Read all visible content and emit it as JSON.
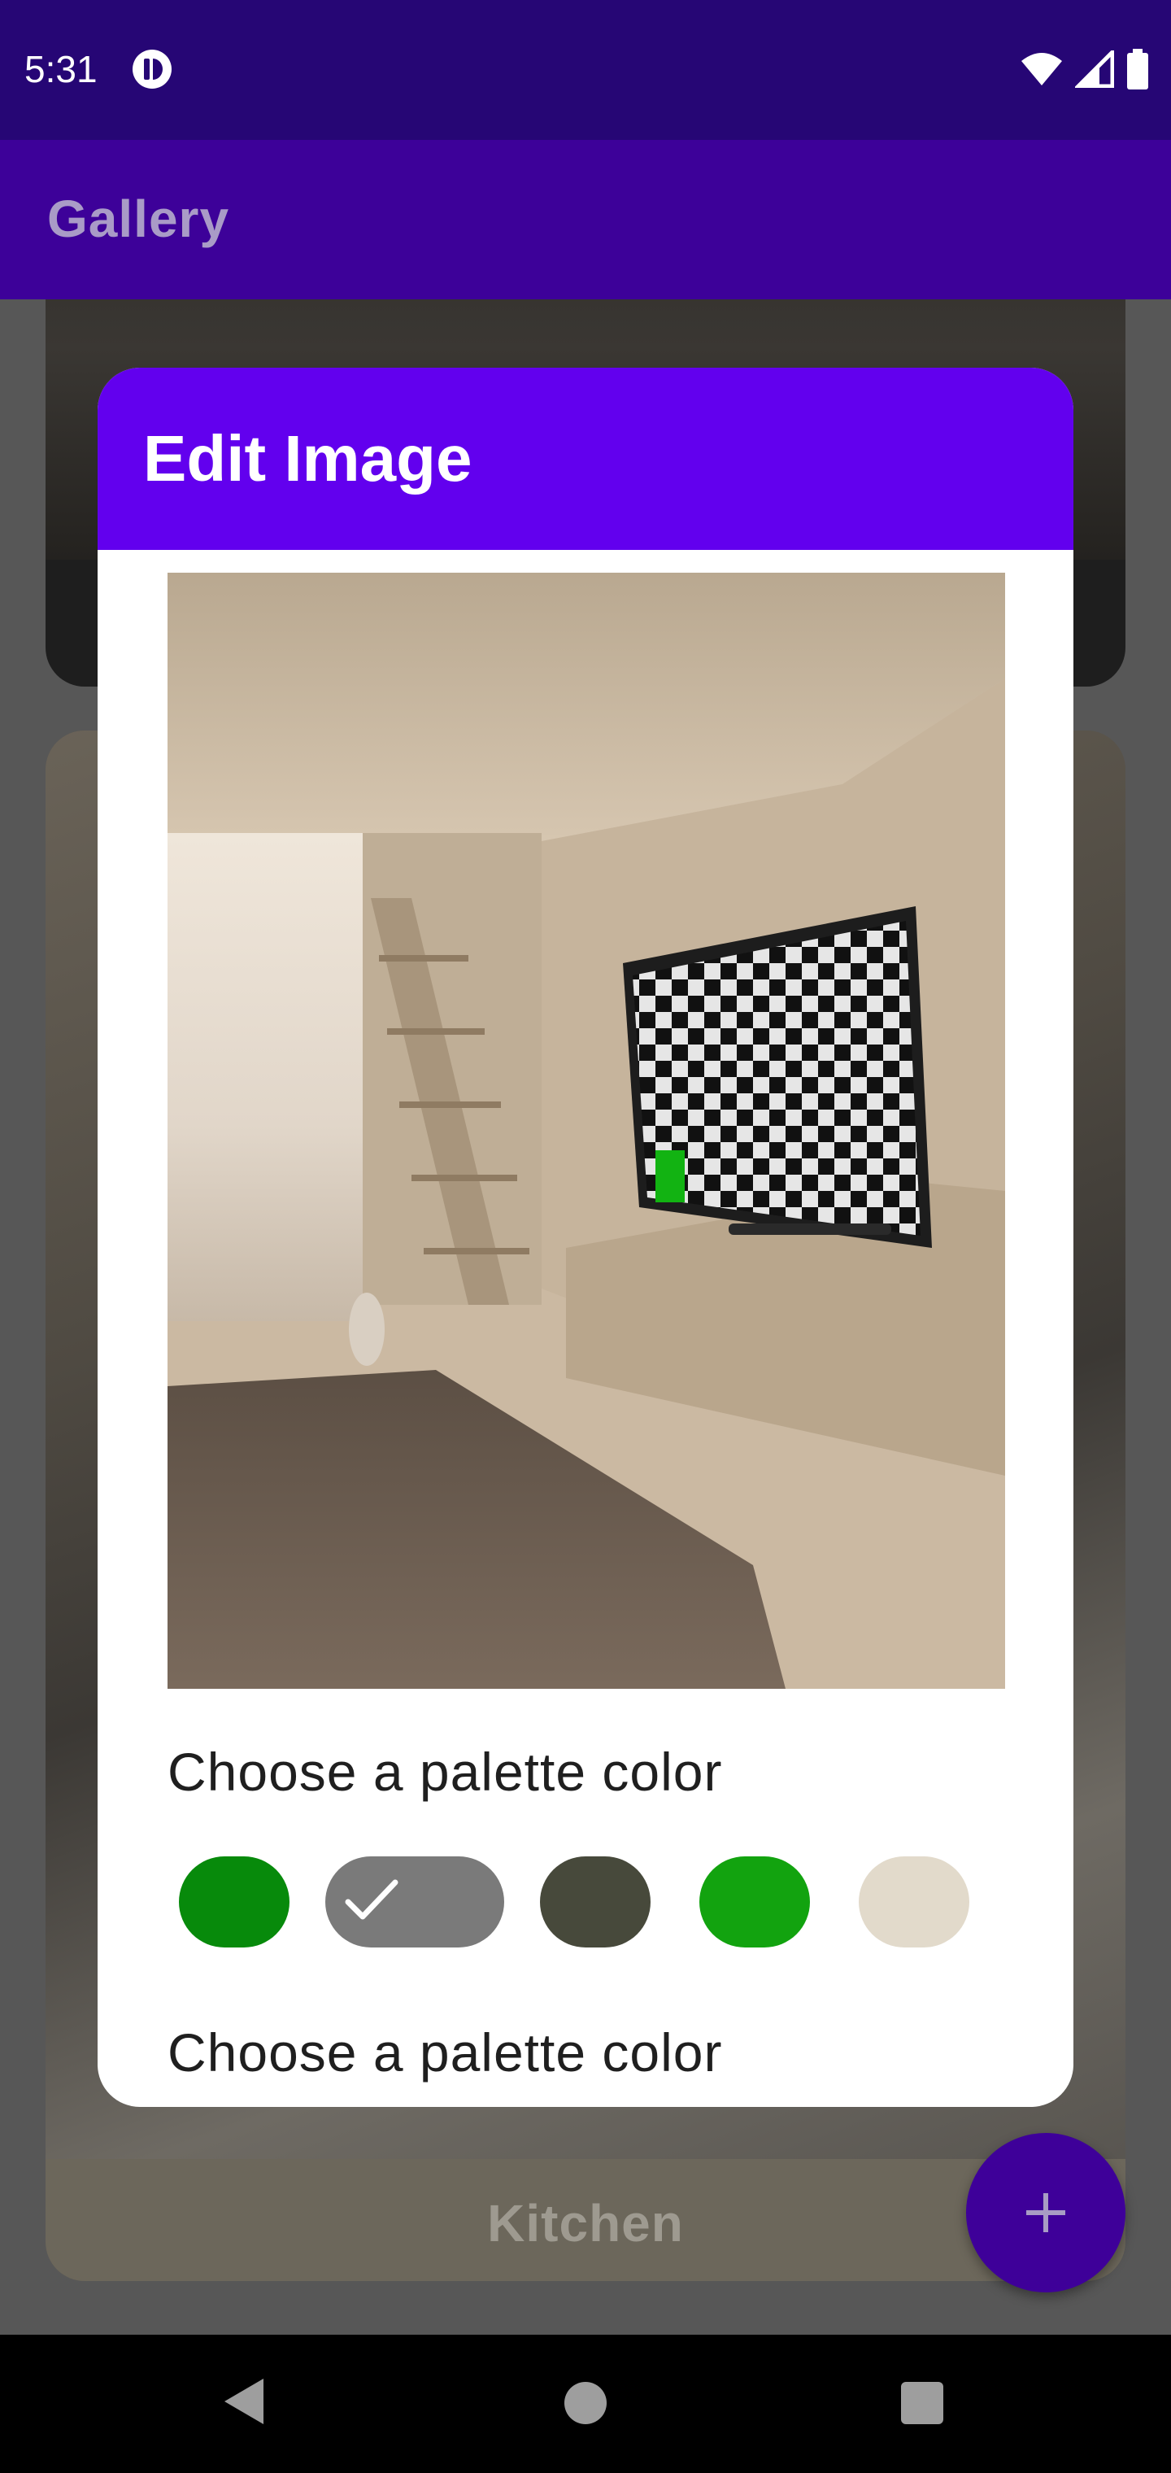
{
  "status_bar": {
    "time": "5:31",
    "icons": [
      "app-notification-icon",
      "wifi-icon",
      "signal-icon",
      "battery-icon"
    ]
  },
  "app_bar": {
    "title": "Gallery"
  },
  "gallery": {
    "cards": [
      {
        "label": ""
      },
      {
        "label": "Kitchen"
      }
    ]
  },
  "dialog": {
    "title": "Edit Image",
    "section_label_1": "Choose a palette color",
    "section_label_2": "Choose a palette color",
    "palette": [
      {
        "color": "#078a0b",
        "selected": false
      },
      {
        "color": "#7a7a7a",
        "selected": true
      },
      {
        "color": "#47493b",
        "selected": false
      },
      {
        "color": "#12a30f",
        "selected": false
      },
      {
        "color": "#e2dacb",
        "selected": false
      }
    ]
  },
  "fab": {
    "icon": "plus-icon"
  },
  "colors": {
    "status_bar": "#260675",
    "app_bar": "#3d0199",
    "dialog_header": "#6200ee",
    "fab": "#3e0099"
  }
}
